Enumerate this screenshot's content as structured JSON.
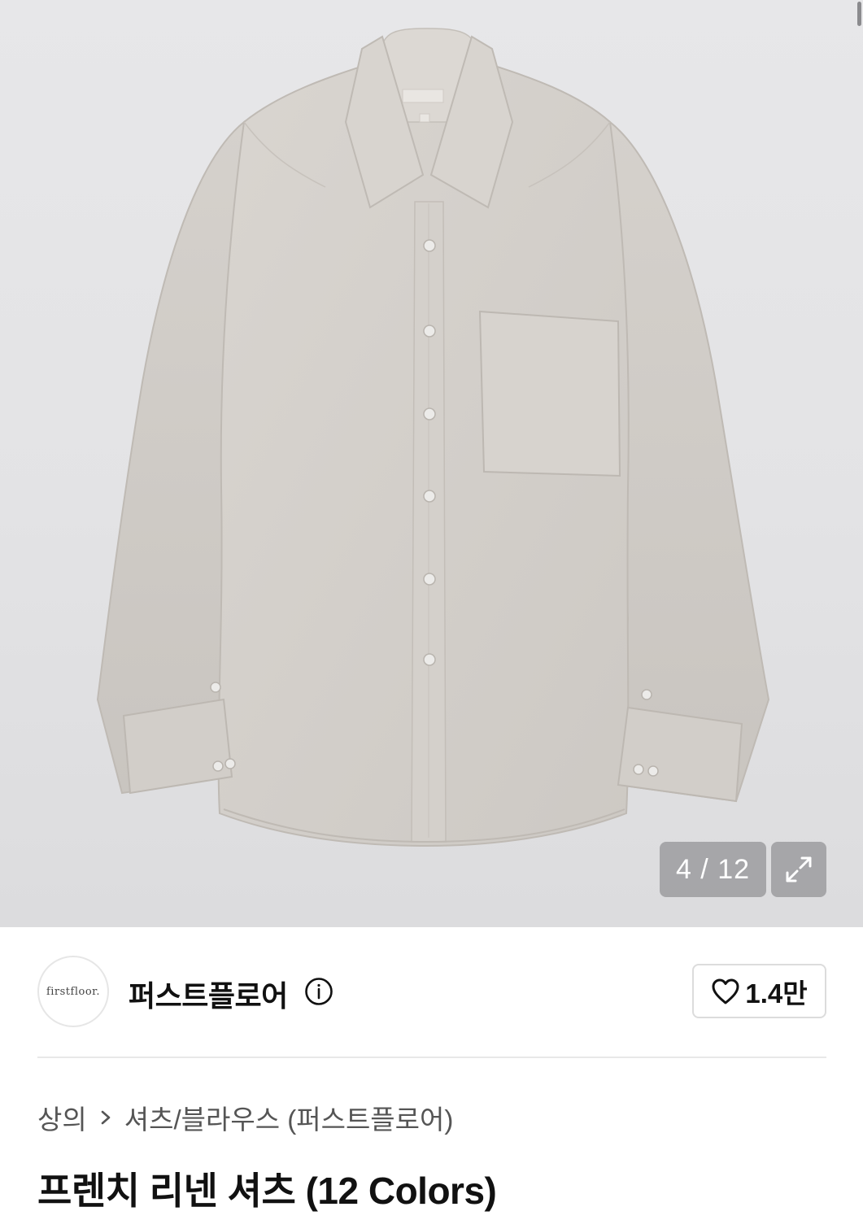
{
  "gallery": {
    "counter": "4 / 12",
    "current_index": 4,
    "total_images": 12,
    "expand_icon": "expand-arrows-icon",
    "logo_tag": "firstfloor."
  },
  "brand": {
    "logo_text": "firstfloor.",
    "name": "퍼스트플로어",
    "info_icon": "info-icon"
  },
  "like": {
    "icon": "heart-outline-icon",
    "count": "1.4만"
  },
  "breadcrumb": {
    "category": "상의",
    "separator_icon": "chevron-right-icon",
    "subcategory": "셔츠/블라우스 (퍼스트플로어)"
  },
  "product": {
    "title": "프렌치 리넨 셔츠 (12 Colors)"
  },
  "colors": {
    "gallery_bg": "#e4e4e6",
    "shirt": "#d6d2cd",
    "overlay": "#7f7f83"
  }
}
